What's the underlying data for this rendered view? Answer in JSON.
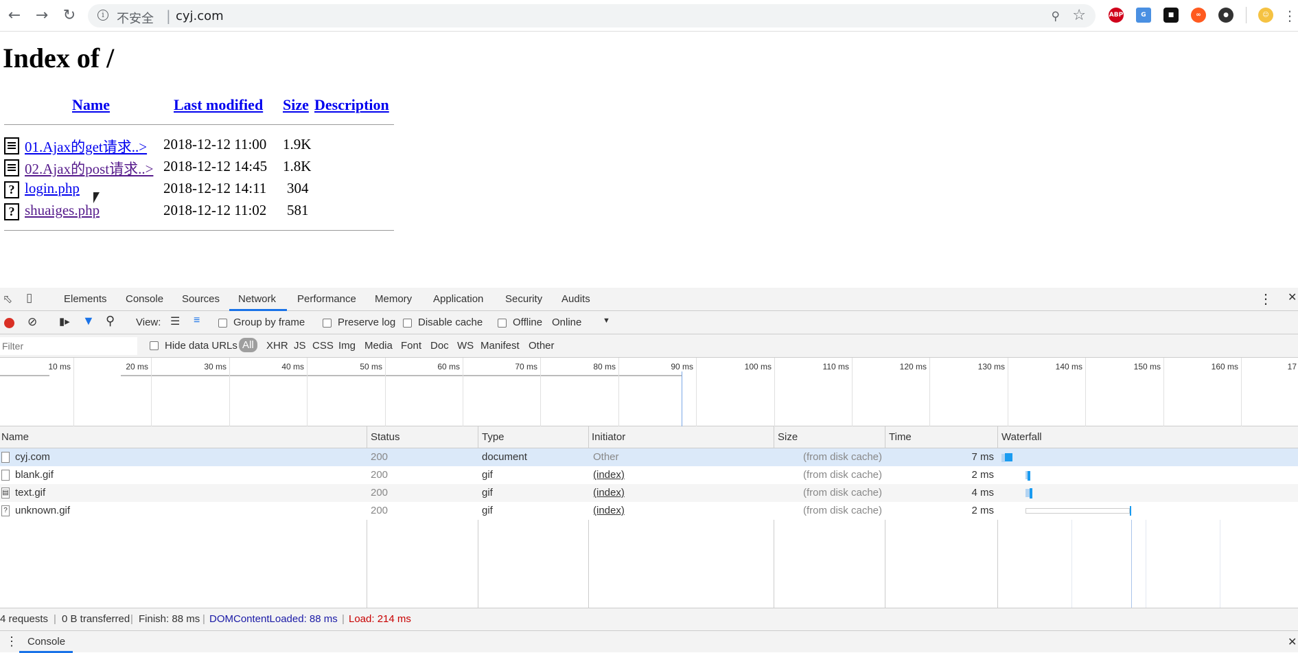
{
  "browser": {
    "insecure_label": "不安全",
    "separator": "|",
    "url": "cyj.com",
    "ext_abp": "ABP"
  },
  "page": {
    "title": "Index of /",
    "columns": {
      "name": "Name",
      "modified": "Last modified",
      "size": "Size",
      "description": "Description"
    },
    "files": [
      {
        "name": "01.Ajax的get请求..>",
        "modified": "2018-12-12 11:00",
        "size": "1.9K",
        "icon": "text-file-icon"
      },
      {
        "name": "02.Ajax的post请求..>",
        "modified": "2018-12-12 14:45",
        "size": "1.8K",
        "icon": "text-file-icon"
      },
      {
        "name": "login.php",
        "modified": "2018-12-12 14:11",
        "size": "304",
        "icon": "unknown-file-icon"
      },
      {
        "name": "shuaiges.php",
        "modified": "2018-12-12 11:02",
        "size": "581",
        "icon": "unknown-file-icon"
      }
    ]
  },
  "devtools": {
    "tabs": [
      "Elements",
      "Console",
      "Sources",
      "Network",
      "Performance",
      "Memory",
      "Application",
      "Security",
      "Audits"
    ],
    "active_tab": "Network",
    "toolbar": {
      "view_label": "View:",
      "group_by_frame": "Group by frame",
      "preserve_log": "Preserve log",
      "disable_cache": "Disable cache",
      "offline": "Offline",
      "throttle": "Online"
    },
    "filter": {
      "placeholder": "Filter",
      "hide_data_urls": "Hide data URLs",
      "types": [
        "All",
        "XHR",
        "JS",
        "CSS",
        "Img",
        "Media",
        "Font",
        "Doc",
        "WS",
        "Manifest",
        "Other"
      ]
    },
    "timeline_ticks": [
      "10 ms",
      "20 ms",
      "30 ms",
      "40 ms",
      "50 ms",
      "60 ms",
      "70 ms",
      "80 ms",
      "90 ms",
      "100 ms",
      "110 ms",
      "120 ms",
      "130 ms",
      "140 ms",
      "150 ms",
      "160 ms",
      "17"
    ],
    "columns": [
      "Name",
      "Status",
      "Type",
      "Initiator",
      "Size",
      "Time",
      "Waterfall"
    ],
    "requests": [
      {
        "name": "cyj.com",
        "status": "200",
        "type": "document",
        "initiator": "Other",
        "size": "(from disk cache)",
        "time": "7 ms"
      },
      {
        "name": "blank.gif",
        "status": "200",
        "type": "gif",
        "initiator": "(index)",
        "size": "(from disk cache)",
        "time": "2 ms"
      },
      {
        "name": "text.gif",
        "status": "200",
        "type": "gif",
        "initiator": "(index)",
        "size": "(from disk cache)",
        "time": "4 ms"
      },
      {
        "name": "unknown.gif",
        "status": "200",
        "type": "gif",
        "initiator": "(index)",
        "size": "(from disk cache)",
        "time": "2 ms"
      }
    ],
    "summary": {
      "requests": "4 requests",
      "transferred": "0 B transferred",
      "finish": "Finish: 88 ms",
      "dcl": "DOMContentLoaded: 88 ms",
      "load": "Load: 214 ms",
      "sep": "|"
    },
    "drawer_tab": "Console",
    "colors": {
      "accent": "#1a73e8",
      "dcl": "#1a1aa6",
      "load": "#c80000",
      "record": "#d93025"
    }
  }
}
